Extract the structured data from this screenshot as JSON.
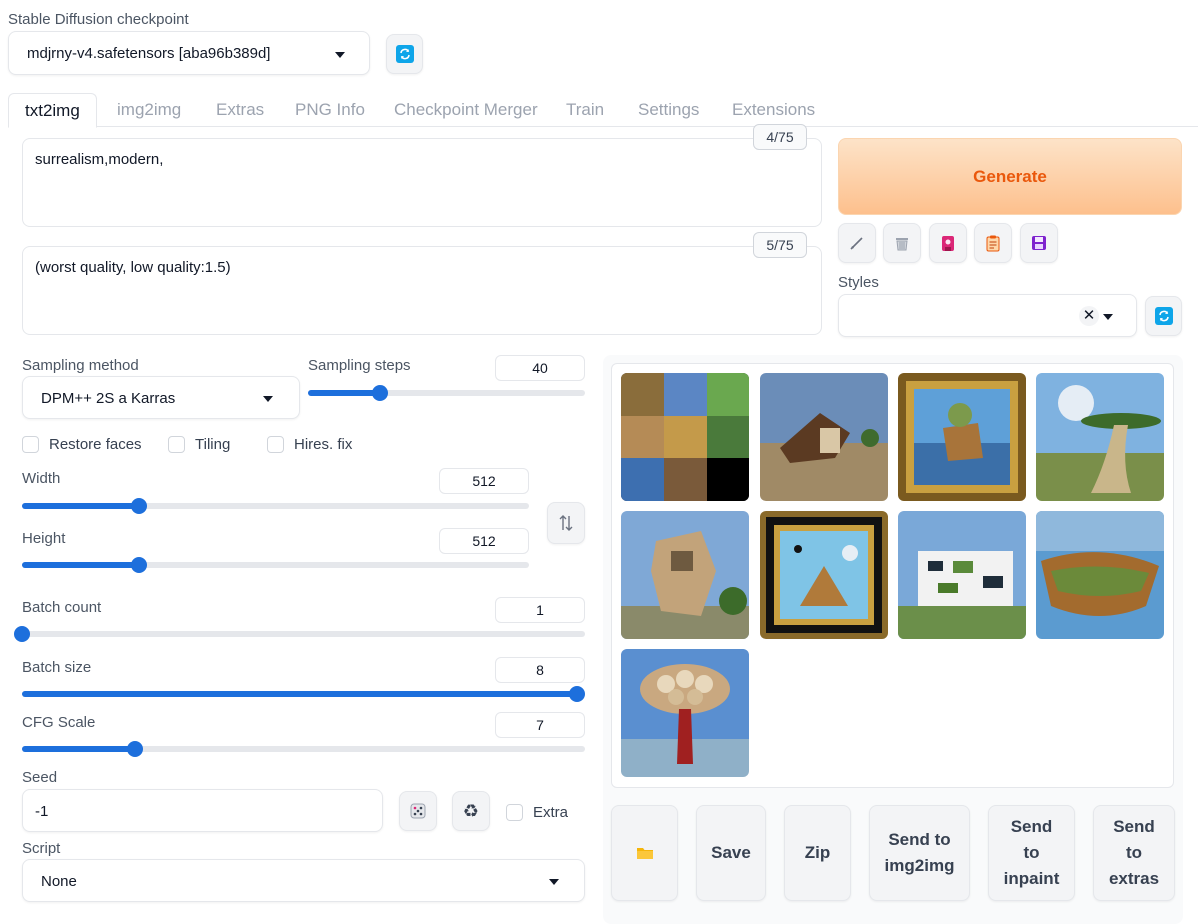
{
  "checkpoint": {
    "label": "Stable Diffusion checkpoint",
    "value": "mdjrny-v4.safetensors [aba96b389d]",
    "refresh_icon": "refresh-icon"
  },
  "tabs": [
    {
      "label": "txt2img",
      "active": true
    },
    {
      "label": "img2img"
    },
    {
      "label": "Extras"
    },
    {
      "label": "PNG Info"
    },
    {
      "label": "Checkpoint Merger"
    },
    {
      "label": "Train"
    },
    {
      "label": "Settings"
    },
    {
      "label": "Extensions"
    }
  ],
  "prompt": {
    "value": "surrealism,modern,",
    "counter": "4/75"
  },
  "negative_prompt": {
    "value": "(worst quality, low quality:1.5)",
    "counter": "5/75"
  },
  "generate": {
    "label": "Generate",
    "color": "#ea580c"
  },
  "tool_buttons": [
    "pencil-icon",
    "trash-icon",
    "bookmark-icon",
    "clipboard-icon",
    "save-disk-icon"
  ],
  "styles": {
    "label": "Styles",
    "value": "",
    "clear_icon": "close-icon"
  },
  "sampling_method": {
    "label": "Sampling method",
    "value": "DPM++ 2S a Karras"
  },
  "sampling_steps": {
    "label": "Sampling steps",
    "value": "40",
    "fraction": 0.26
  },
  "checkboxes": {
    "restore_faces": "Restore faces",
    "tiling": "Tiling",
    "hires_fix": "Hires. fix"
  },
  "width": {
    "label": "Width",
    "value": "512",
    "fraction": 0.23
  },
  "height": {
    "label": "Height",
    "value": "512",
    "fraction": 0.23
  },
  "swap_icon": "swap-vertical-icon",
  "batch_count": {
    "label": "Batch count",
    "value": "1",
    "fraction": 0.0
  },
  "batch_size": {
    "label": "Batch size",
    "value": "8",
    "fraction": 1.0
  },
  "cfg_scale": {
    "label": "CFG Scale",
    "value": "7",
    "fraction": 0.2
  },
  "seed": {
    "label": "Seed",
    "value": "-1",
    "dice_icon": "dice-icon",
    "reuse_icon": "recycle-icon",
    "extra_label": "Extra"
  },
  "script": {
    "label": "Script",
    "value": "None"
  },
  "gallery_images": [
    "image-1",
    "image-2",
    "image-3",
    "image-4",
    "image-5",
    "image-6",
    "image-7",
    "image-8",
    "image-9"
  ],
  "actions": {
    "folder_icon": "folder-icon",
    "save": "Save",
    "zip": "Zip",
    "send_img2img": "Send to img2img",
    "send_inpaint": "Send to inpaint",
    "send_extras": "Send to extras"
  },
  "colors": {
    "accent": "#1d6fdc",
    "generate_bg": "#fed7aa",
    "refresh": "#0ea5e9"
  }
}
